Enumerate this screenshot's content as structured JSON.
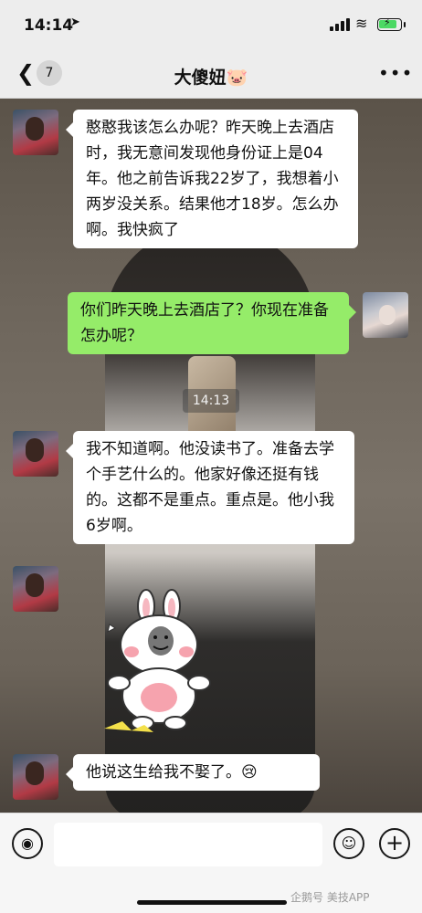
{
  "status_bar": {
    "time": "14:14",
    "location_icon": "location-arrow-icon",
    "battery_level": 0.85
  },
  "nav": {
    "back_icon": "chevron-left-icon",
    "unread_count": "7",
    "title": "大傻妞🐷",
    "more_icon": "more-dots-icon"
  },
  "messages": [
    {
      "side": "left",
      "text": "憨憨我该怎么办呢？昨天晚上去酒店时，我无意间发现他身份证上是04年。他之前告诉我22岁了，我想着小两岁没关系。结果他才18岁。怎么办啊。我快疯了"
    },
    {
      "side": "right",
      "text": "你们昨天晚上去酒店了？你现在准备怎办呢？"
    },
    {
      "side": "time",
      "text": "14:13"
    },
    {
      "side": "left",
      "text": "我不知道啊。他没读书了。准备去学个手艺什么的。他家好像还挺有钱的。这都不是重点。重点是。他小我6岁啊。"
    },
    {
      "side": "left",
      "type": "sticker",
      "sticker_icon": "rabbit-sticker-icon"
    },
    {
      "side": "left",
      "text": "他说这生给我不娶了。😢"
    }
  ],
  "input_bar": {
    "voice_icon": "voice-icon",
    "emoji_icon": "emoji-icon",
    "plus_icon": "plus-icon"
  },
  "watermark": "企鹅号 美技APP",
  "colors": {
    "sent_bubble": "#95ec69",
    "received_bubble": "#ffffff",
    "nav_bg": "#ededed"
  }
}
